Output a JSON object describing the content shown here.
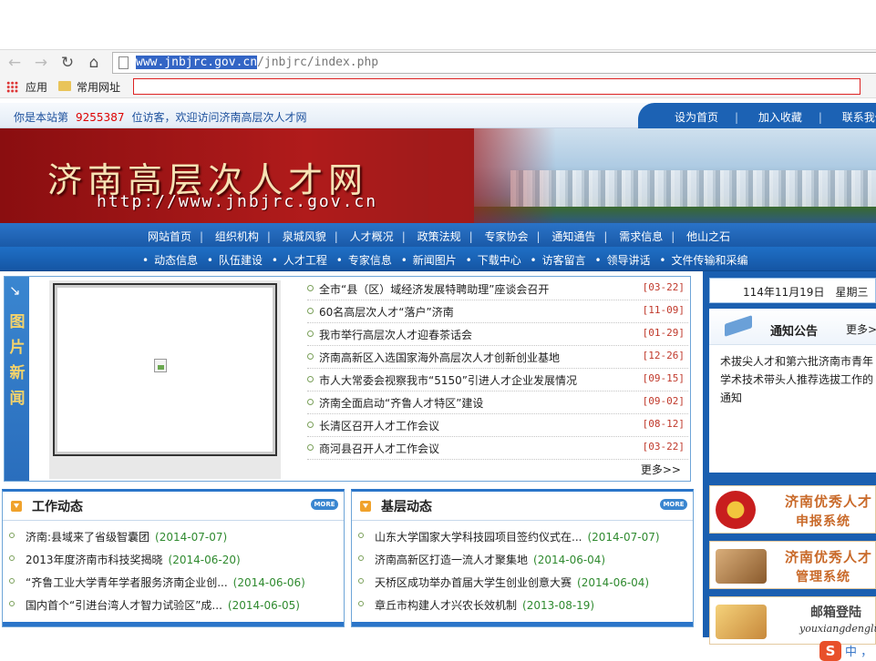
{
  "browser": {
    "url_selected": "www.jnbjrc.gov.cn",
    "url_rest": "/jnbjrc/index.php",
    "bookmarks": [
      "应用",
      "常用网址"
    ]
  },
  "topbar": {
    "visitor_prefix": "你是本站第",
    "visitor_count": "9255387",
    "visitor_suffix": "位访客，欢迎访问济南高层次人才网",
    "links": [
      "设为首页",
      "加入收藏",
      "联系我们"
    ]
  },
  "banner": {
    "title": "济南高层次人才网",
    "url": "http://www.jnbjrc.gov.cn"
  },
  "menu_main": [
    "网站首页",
    "组织机构",
    "泉城风貌",
    "人才概况",
    "政策法规",
    "专家协会",
    "通知通告",
    "需求信息",
    "他山之石"
  ],
  "menu_sub": [
    "动态信息",
    "队伍建设",
    "人才工程",
    "专家信息",
    "新闻图片",
    "下载中心",
    "访客留言",
    "领导讲话",
    "文件传输和采编"
  ],
  "picnews": {
    "side_arrow": "↘",
    "side_label": "图片新闻",
    "items": [
      {
        "title": "全市“县（区）域经济发展特聘助理”座谈会召开",
        "date": "[03-22]"
      },
      {
        "title": "60名高层次人才“落户”济南",
        "date": "[11-09]"
      },
      {
        "title": "我市举行高层次人才迎春茶话会",
        "date": "[01-29]"
      },
      {
        "title": "济南高新区入选国家海外高层次人才创新创业基地",
        "date": "[12-26]"
      },
      {
        "title": "市人大常委会视察我市“5150”引进人才企业发展情况",
        "date": "[09-15]"
      },
      {
        "title": "济南全面启动“齐鲁人才特区”建设",
        "date": "[09-02]"
      },
      {
        "title": "长清区召开人才工作会议",
        "date": "[08-12]"
      },
      {
        "title": "商河县召开人才工作会议",
        "date": "[03-22]"
      }
    ],
    "more": "更多>>"
  },
  "right": {
    "date": "114年11月19日　星期三",
    "notice_title": "通知公告",
    "notice_more": "更多>>",
    "notice_body": "术拔尖人才和第六批济南市青年学术技术带头人推荐选拔工作的通知",
    "banner1_l1": "济南优秀人才",
    "banner1_l2": "申报系统",
    "banner2_l1": "济南优秀人才",
    "banner2_l2": "管理系统",
    "banner3_l1": "邮箱登陆",
    "banner3_l2": "youxiangdenglu",
    "ime_s": "S",
    "ime_zh": "中 ，"
  },
  "work": {
    "title": "工作动态",
    "more": "MORE",
    "items": [
      {
        "title": "济南:县域来了省级智囊团",
        "date": "(2014-07-07)"
      },
      {
        "title": "2013年度济南市科技奖揭晓",
        "date": "(2014-06-20)"
      },
      {
        "title": "“齐鲁工业大学青年学者服务济南企业创...",
        "date": "(2014-06-06)"
      },
      {
        "title": "国内首个“引进台湾人才智力试验区”成...",
        "date": "(2014-06-05)"
      }
    ]
  },
  "base": {
    "title": "基层动态",
    "more": "MORE",
    "items": [
      {
        "title": "山东大学国家大学科技园项目签约仪式在...",
        "date": "(2014-07-07)"
      },
      {
        "title": "济南高新区打造一流人才聚集地",
        "date": "(2014-06-04)"
      },
      {
        "title": "天桥区成功举办首届大学生创业创意大赛",
        "date": "(2014-06-04)"
      },
      {
        "title": "章丘市构建人才兴农长效机制",
        "date": "(2013-08-19)"
      }
    ]
  }
}
